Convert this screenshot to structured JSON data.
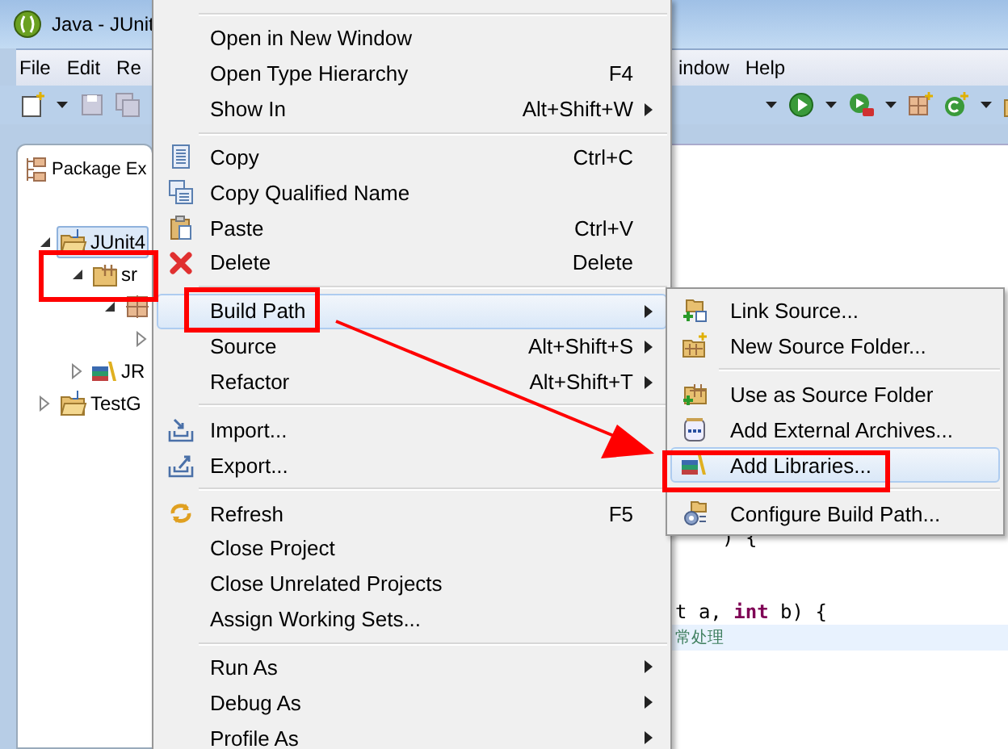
{
  "window": {
    "title": "Java - JUnit"
  },
  "menu_bar": {
    "items": [
      "File",
      "Edit",
      "Re"
    ],
    "items_right": [
      "indow",
      "Help"
    ]
  },
  "package_explorer": {
    "tab": "Package Ex",
    "tree": [
      {
        "kind": "project",
        "label": "JUnit4",
        "expanded": true,
        "selected": true,
        "children": [
          {
            "kind": "source-folder",
            "label": "sr",
            "expanded": true,
            "selected": false,
            "children": [
              {
                "kind": "package",
                "expanded": true,
                "selected": false,
                "children": [
                  {
                    "expanded": false
                  }
                ]
              }
            ]
          },
          {
            "kind": "library",
            "label": "JR",
            "expanded": false,
            "selected": false
          }
        ]
      },
      {
        "kind": "project",
        "label": "TestG",
        "expanded": false,
        "selected": false
      }
    ]
  },
  "editor": {
    "lines": [
      {
        "text": ") {",
        "highlighted": false
      },
      {
        "text": "t a, **int** b) {",
        "highlighted": false
      },
      {
        "text": "常处理",
        "highlighted": true
      }
    ]
  },
  "context_menu": {
    "groups": [
      {
        "items": [
          {
            "kind": "plain",
            "label": "Open in New Window",
            "has_submenu": false,
            "selected": false
          },
          {
            "kind": "plain",
            "label": "Open Type Hierarchy",
            "shortcut": "F4",
            "has_submenu": false,
            "selected": false
          },
          {
            "kind": "plain",
            "label": "Show In",
            "shortcut": "Alt+Shift+W",
            "has_submenu": true,
            "selected": false
          }
        ]
      },
      {
        "items": [
          {
            "kind": "copy",
            "label": "Copy",
            "shortcut": "Ctrl+C",
            "has_submenu": false,
            "selected": false
          },
          {
            "kind": "copy-name",
            "label": "Copy Qualified Name",
            "has_submenu": false,
            "selected": false
          },
          {
            "kind": "paste",
            "label": "Paste",
            "shortcut": "Ctrl+V",
            "has_submenu": false,
            "selected": false
          },
          {
            "kind": "delete",
            "label": "Delete",
            "shortcut": "Delete",
            "has_submenu": false,
            "selected": false
          }
        ]
      },
      {
        "items": [
          {
            "kind": "plain",
            "label": "Build Path",
            "has_submenu": true,
            "selected": true
          },
          {
            "kind": "plain",
            "label": "Source",
            "shortcut": "Alt+Shift+S",
            "has_submenu": true,
            "selected": false
          },
          {
            "kind": "plain",
            "label": "Refactor",
            "shortcut": "Alt+Shift+T",
            "has_submenu": true,
            "selected": false
          }
        ]
      },
      {
        "items": [
          {
            "kind": "import",
            "label": "Import...",
            "has_submenu": false,
            "selected": false
          },
          {
            "kind": "export",
            "label": "Export...",
            "has_submenu": false,
            "selected": false
          }
        ]
      },
      {
        "items": [
          {
            "kind": "refresh",
            "label": "Refresh",
            "shortcut": "F5",
            "has_submenu": false,
            "selected": false
          },
          {
            "kind": "plain",
            "label": "Close Project",
            "has_submenu": false,
            "selected": false
          },
          {
            "kind": "plain",
            "label": "Close Unrelated Projects",
            "has_submenu": false,
            "selected": false
          },
          {
            "kind": "plain",
            "label": "Assign Working Sets...",
            "has_submenu": false,
            "selected": false
          }
        ]
      },
      {
        "items": [
          {
            "kind": "plain",
            "label": "Run As",
            "has_submenu": true,
            "selected": false
          },
          {
            "kind": "plain",
            "label": "Debug As",
            "has_submenu": true,
            "selected": false
          },
          {
            "kind": "plain",
            "label": "Profile As",
            "has_submenu": true,
            "selected": false
          }
        ]
      }
    ]
  },
  "submenu": {
    "groups": [
      {
        "items": [
          {
            "kind": "link-source",
            "label": "Link Source...",
            "has_submenu": false,
            "selected": false
          },
          {
            "kind": "new-source-folder",
            "label": "New Source Folder...",
            "has_submenu": false,
            "selected": false
          }
        ]
      },
      {
        "items": [
          {
            "kind": "use-as-source",
            "label": "Use as Source Folder",
            "has_submenu": false,
            "selected": false
          },
          {
            "kind": "archives",
            "label": "Add External Archives...",
            "has_submenu": false,
            "selected": false
          },
          {
            "kind": "libraries",
            "label": "Add Libraries...",
            "has_submenu": false,
            "selected": true
          }
        ]
      },
      {
        "items": [
          {
            "kind": "configure",
            "label": "Configure Build Path...",
            "has_submenu": false,
            "selected": false
          }
        ]
      }
    ]
  }
}
